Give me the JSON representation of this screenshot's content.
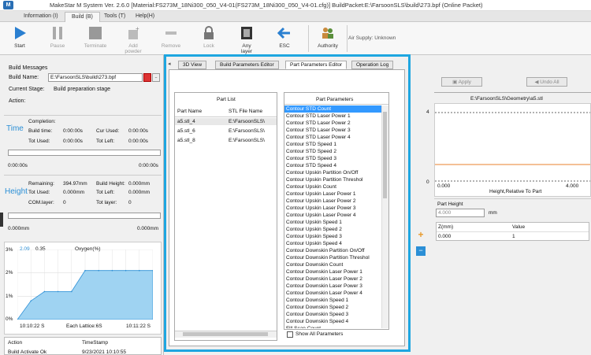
{
  "app": {
    "title": "MakeStar M System   Ver. 2.6.0 [Material:FS273M_18Ni300_050_V4-01(FS273M_18Ni300_050_V4-01.cfg)]  BuildPacket:E:\\FarsoonSLS\\build\\273.bpf   (Online Packet)"
  },
  "menu": [
    "Information (I)",
    "Build (B)",
    "Tools (T)",
    "Help(H)"
  ],
  "toolbar": {
    "start": "Start",
    "pause": "Pause",
    "terminate": "Terminate",
    "add_powder": "Add\npowder",
    "remove": "Remove",
    "lock": "Lock",
    "any_layer": "Any\nlayer",
    "esc": "ESC",
    "authority": "Authority",
    "air_supply": "Air Supply: Unknown"
  },
  "build": {
    "section": "Build Messages",
    "name_label": "Build Name:",
    "name_value": "E:\\FarsoonSLS\\build\\273.bpf",
    "stage_label": "Current Stage:",
    "stage_value": "Build preparation stage",
    "action_label": "Action:"
  },
  "time": {
    "label": "Time",
    "completion": "Completion:",
    "build_time_label": "Build time:",
    "build_time": "0:00:00s",
    "cur_used_label": "Cur Used:",
    "cur_used": "0:00:00s",
    "tot_used_label": "Tot Used:",
    "tot_used": "0:00:00s",
    "tot_left_label": "Tot Left:",
    "tot_left": "0:00:00s",
    "bar_left": "0:00:00s",
    "bar_right": "0:00:00s"
  },
  "height": {
    "label": "Height",
    "remaining_label": "Remaining:",
    "remaining": "394.97mm",
    "build_height_label": "Build Height:",
    "build_height": "0.000mm",
    "tot_used_label": "Tot Used:",
    "tot_used": "0.000mm",
    "tot_left_label": "Tot Left:",
    "tot_left": "0.000mm",
    "com_layer_label": "COM.layer:",
    "com_layer": "0",
    "tot_layer_label": "Tot layer:",
    "tot_layer": "0",
    "bar_left": "0.000mm",
    "bar_right": "0.000mm"
  },
  "oxygen": {
    "current_a": "2.09",
    "current_b": "0.35",
    "title": "Oxygen(%)",
    "y_ticks": [
      "3%",
      "2%",
      "1%",
      "0%"
    ],
    "x_start": "10:10:22 S",
    "x_end": "10:11:22 S",
    "lattice": "Each Lattice:6S"
  },
  "chart_data": {
    "type": "area",
    "title": "Oxygen(%)",
    "xlabel": "",
    "ylabel": "",
    "ylim": [
      0,
      3
    ],
    "x": [
      0,
      1,
      2,
      3,
      4,
      5,
      6,
      7,
      8,
      9,
      10
    ],
    "values": [
      0,
      0.8,
      1.2,
      1.2,
      1.2,
      2.1,
      2.1,
      2.1,
      2.1,
      2.1,
      2.1
    ]
  },
  "action_log": {
    "col_action": "Action",
    "col_time": "TimeStamp",
    "rows": [
      {
        "action": "Build Activate Ok",
        "time": "9/23/2021  10:10:55"
      }
    ]
  },
  "editor_tabs": [
    "3D View",
    "Build Parameters Editor",
    "Part Parameters Editor",
    "Operation Log"
  ],
  "part_list": {
    "title": "Part List",
    "col_name": "Part Name",
    "col_file": "STL File Name",
    "rows": [
      {
        "name": "a5.stl_4",
        "file": "E:\\FarsoonSLS\\"
      },
      {
        "name": "a5.stl_6",
        "file": "E:\\FarsoonSLS\\"
      },
      {
        "name": "a5.stl_8",
        "file": "E:\\FarsoonSLS\\"
      }
    ]
  },
  "part_params": {
    "title": "Part Parameters",
    "items": [
      "Contour STD Count",
      "Contour STD Laser Power 1",
      "Contour STD Laser Power 2",
      "Contour STD Laser Power 3",
      "Contour STD Laser Power 4",
      "Contour STD Speed 1",
      "Contour STD Speed 2",
      "Contour STD Speed 3",
      "Contour STD Speed 4",
      "Contour Upskin Partition On/Off",
      "Contour Upskin Partition Threshol",
      "Contour Upskin Count",
      "Contour Upskin Laser Power 1",
      "Contour Upskin Laser Power 2",
      "Contour Upskin Laser Power 3",
      "Contour Upskin Laser Power 4",
      "Contour Upskin Speed 1",
      "Contour Upskin Speed 2",
      "Contour Upskin Speed 3",
      "Contour Upskin Speed 4",
      "Contour Downskin Partition On/Off",
      "Contour Downskin Partition Threshol",
      "Contour Downskin Count",
      "Contour Downskin Laser Power 1",
      "Contour Downskin Laser Power 2",
      "Contour Downskin Laser Power 3",
      "Contour Downskin Laser Power 4",
      "Contour Downskin Speed 1",
      "Contour Downskin Speed 2",
      "Contour Downskin Speed 3",
      "Contour Downskin Speed 4",
      "Fill Scan Count"
    ],
    "show_all": "Show All Parameters"
  },
  "right": {
    "apply": "Apply",
    "undo_all": "Undo All",
    "geometry_path": "E:\\FarsoonSLS\\Geometry\\a5.stl",
    "y_top": "4",
    "y_bottom": "0",
    "x_min": "0.000",
    "x_max": "4.000",
    "x_title": "Height,Relative To Part",
    "part_height_label": "Part Height",
    "part_height": "4.000",
    "unit": "mm",
    "col_z": "Z(mm)",
    "col_value": "Value",
    "row_z": "0.000",
    "row_value": "1"
  },
  "colors": {
    "accent": "#1ea6e0",
    "selection": "#3399ff",
    "chart_fill": "#9fd3f2",
    "chart_line": "#2b8fd6"
  }
}
